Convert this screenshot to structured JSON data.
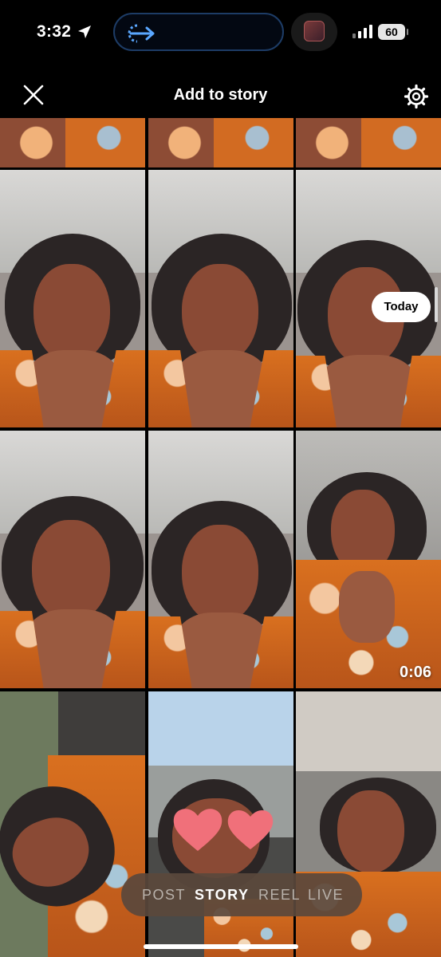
{
  "status_bar": {
    "time": "3:32",
    "battery": "60",
    "icons": [
      "location-arrow-icon",
      "back-to-app-icon",
      "app-thumbnail-icon",
      "signal-icon",
      "battery-icon"
    ]
  },
  "header": {
    "title": "Add to story",
    "close_icon": "close-icon",
    "settings_icon": "gear-icon"
  },
  "gallery": {
    "date_label": "Today",
    "video_duration": "0:06",
    "accent_colors": {
      "dress": "#d26b22",
      "hearts": "#f0707a"
    }
  },
  "mode_selector": {
    "items": [
      {
        "label": "POST",
        "active": false
      },
      {
        "label": "STORY",
        "active": true
      },
      {
        "label": "REEL",
        "active": false
      },
      {
        "label": "LIVE",
        "active": false
      }
    ]
  }
}
